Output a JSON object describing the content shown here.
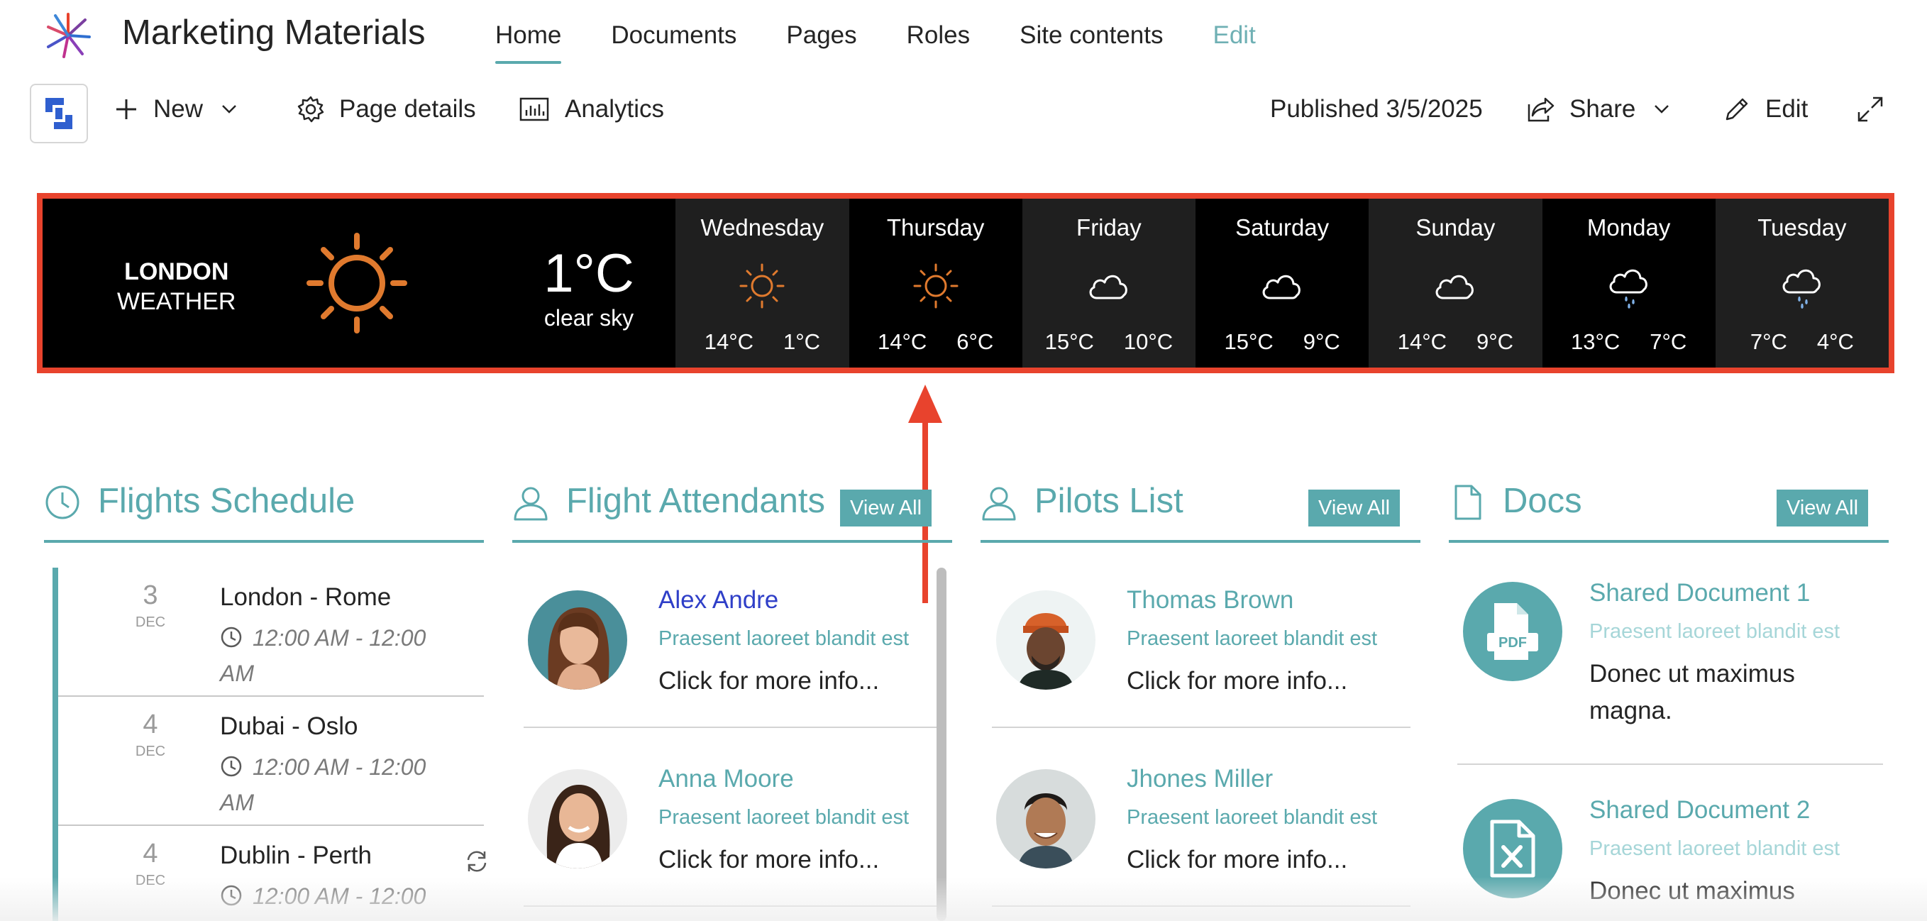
{
  "site": {
    "title": "Marketing Materials"
  },
  "nav": [
    "Home",
    "Documents",
    "Pages",
    "Roles",
    "Site contents",
    "Edit"
  ],
  "commandbar": {
    "new_label": "New",
    "page_details_label": "Page details",
    "analytics_label": "Analytics",
    "published_label": "Published 3/5/2025",
    "share_label": "Share",
    "edit_label": "Edit"
  },
  "weather": {
    "city_line1": "LONDON",
    "city_line2": "WEATHER",
    "current_temp": "1°C",
    "current_desc": "clear sky",
    "days": [
      {
        "name": "Wednesday",
        "icon": "sun-icon",
        "high": "14°C",
        "low": "1°C"
      },
      {
        "name": "Thursday",
        "icon": "sun-icon",
        "high": "14°C",
        "low": "6°C"
      },
      {
        "name": "Friday",
        "icon": "cloud-icon",
        "high": "15°C",
        "low": "10°C"
      },
      {
        "name": "Saturday",
        "icon": "cloud-icon",
        "high": "15°C",
        "low": "9°C"
      },
      {
        "name": "Sunday",
        "icon": "cloud-icon",
        "high": "14°C",
        "low": "9°C"
      },
      {
        "name": "Monday",
        "icon": "rain-cloud-icon",
        "high": "13°C",
        "low": "7°C"
      },
      {
        "name": "Tuesday",
        "icon": "rain-cloud-icon",
        "high": "7°C",
        "low": "4°C"
      }
    ]
  },
  "flights": {
    "title": "Flights Schedule",
    "items": [
      {
        "day": "3",
        "month": "DEC",
        "route": "London - Rome",
        "time": "12:00 AM - 12:00 AM"
      },
      {
        "day": "4",
        "month": "DEC",
        "route": "Dubai - Oslo",
        "time": "12:00 AM - 12:00 AM"
      },
      {
        "day": "4",
        "month": "DEC",
        "route": "Dublin - Perth",
        "time": "12:00 AM - 12:00"
      }
    ]
  },
  "attendants": {
    "title": "Flight Attendants",
    "view_all": "View All",
    "items": [
      {
        "name": "Alex Andre",
        "sub": "Praesent laoreet blandit est",
        "more": "Click for more info..."
      },
      {
        "name": "Anna Moore",
        "sub": "Praesent laoreet blandit est",
        "more": "Click for more info..."
      }
    ]
  },
  "pilots": {
    "title": "Pilots List",
    "view_all": "View All",
    "items": [
      {
        "name": "Thomas Brown",
        "sub": "Praesent laoreet blandit est",
        "more": "Click for more info..."
      },
      {
        "name": "Jhones Miller",
        "sub": "Praesent laoreet blandit est",
        "more": "Click for more info..."
      }
    ]
  },
  "docs": {
    "title": "Docs",
    "view_all": "View All",
    "items": [
      {
        "name": "Shared Document 1",
        "sub": "Praesent laoreet blandit est",
        "desc": "Donec ut maximus magna.",
        "icon": "pdf-file-icon",
        "icon_label": "PDF"
      },
      {
        "name": "Shared Document 2",
        "sub": "Praesent laoreet blandit est",
        "desc": "Donec ut maximus",
        "icon": "excel-file-icon"
      }
    ]
  },
  "colors": {
    "accent": "#5aa9ad",
    "highlight": "#e8432d",
    "weather_bg": "#000000",
    "sun": "#e07a2e"
  }
}
